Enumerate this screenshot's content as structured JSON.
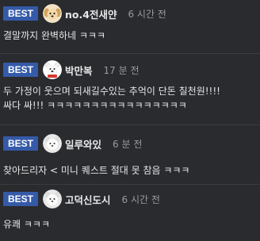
{
  "comments": [
    {
      "badge": "BEST",
      "nickname": "no.4전새얀",
      "time": "6 시간 전",
      "text": "결말까지 완벽하네 ㅋㅋㅋ",
      "avatar": "dog-avatar-icon"
    },
    {
      "badge": "BEST",
      "nickname": "박만복",
      "time": "17 분 전",
      "text": "두 가정이 웃으며 되새길수있는 추억이 단돈 칠천원!!!!\n싸다 싸!!! ㅋㅋㅋㅋㅋㅋㅋㅋㅋㅋㅋㅋㅋㅋㅋㅋ",
      "avatar": "polar-bear-avatar-icon"
    },
    {
      "badge": "BEST",
      "nickname": "일루와있",
      "time": "6 분 전",
      "text": "찾아드리자 < 미니 퀘스트 절대 못 참음 ㅋㅋㅋ",
      "avatar": "white-dog-avatar-icon"
    },
    {
      "badge": "BEST",
      "nickname": "고덕신도시",
      "time": "6 시간 전",
      "text": "유쾌 ㅋㅋㅋ",
      "avatar": "white-dog-avatar-icon"
    }
  ]
}
